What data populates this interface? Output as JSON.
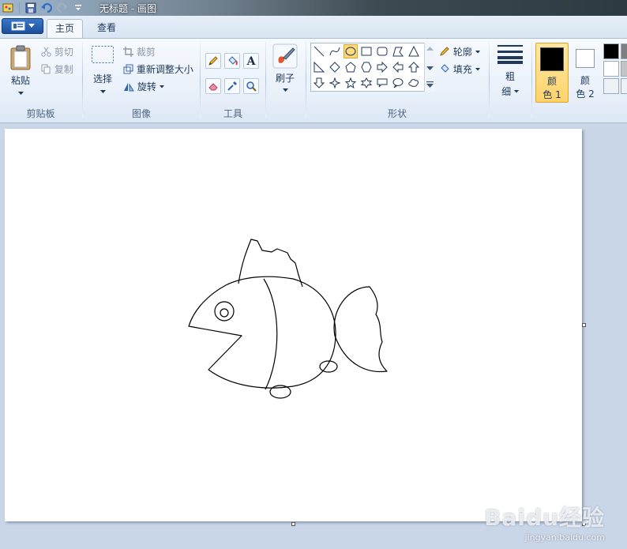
{
  "window": {
    "title": "无标题 - 画图"
  },
  "tabs": [
    {
      "label": "主页",
      "active": true
    },
    {
      "label": "查看",
      "active": false
    }
  ],
  "clipboard": {
    "paste": "粘贴",
    "cut": "剪切",
    "copy": "复制",
    "group": "剪贴板"
  },
  "image": {
    "select": "选择",
    "crop": "裁剪",
    "resize": "重新调整大小",
    "rotate": "旋转",
    "group": "图像"
  },
  "tools": {
    "group": "工具"
  },
  "brushes": {
    "label": "刷子"
  },
  "shapes": {
    "group": "形状",
    "outline": "轮廓",
    "fill": "填充"
  },
  "size": {
    "label_line1": "粗",
    "label_line2": "细"
  },
  "colors": {
    "color1_line1": "颜",
    "color1_line2": "色 1",
    "color2_line1": "颜",
    "color2_line2": "色 2",
    "color1_value": "#000000",
    "color2_value": "#ffffff",
    "palette": [
      "#000000",
      "#7f7f7f",
      "#ffffff",
      "#c3c3c3"
    ]
  },
  "watermark": {
    "main": "Baidu经验",
    "sub": "jingyan.baidu.com"
  }
}
